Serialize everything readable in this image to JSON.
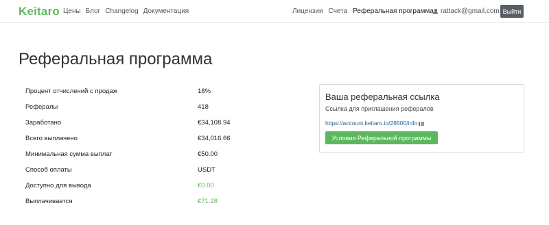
{
  "brand": {
    "logo": "Keitaro"
  },
  "nav": {
    "left": [
      "Цены",
      "Блог",
      "Changelog",
      "Документация"
    ],
    "right": [
      "Лицензии",
      "Счета",
      "Реферальная программа"
    ],
    "user_email": "rattack@gmail.com",
    "logout_label": "Выйти"
  },
  "page": {
    "title": "Реферальная программа"
  },
  "stats": [
    {
      "label": "Процент отчислений с продаж",
      "value": "18%"
    },
    {
      "label": "Рефералы",
      "value": "418"
    },
    {
      "label": "Заработано",
      "value": "€34,108.94"
    },
    {
      "label": "Всего выплачено",
      "value": "€34,016.66"
    },
    {
      "label": "Минимальная сумма выплат",
      "value": "€50.00"
    },
    {
      "label": "Способ оплаты",
      "value": "USDT"
    },
    {
      "label": "Доступно для вывода",
      "value": "€0.00",
      "highlight": true
    },
    {
      "label": "Выплачивается",
      "value": "€71.28",
      "highlight": true
    }
  ],
  "referral": {
    "title": "Ваша реферальная ссылка",
    "subtitle": "Ссылка для приглашения рефералов",
    "link": "https://account.keitaro.io/28500/info",
    "button_label": "Условия Реферальной программы"
  },
  "colors": {
    "accent": "#5cb85c",
    "link": "#2a6496",
    "logout_bg": "#5a5f66"
  }
}
